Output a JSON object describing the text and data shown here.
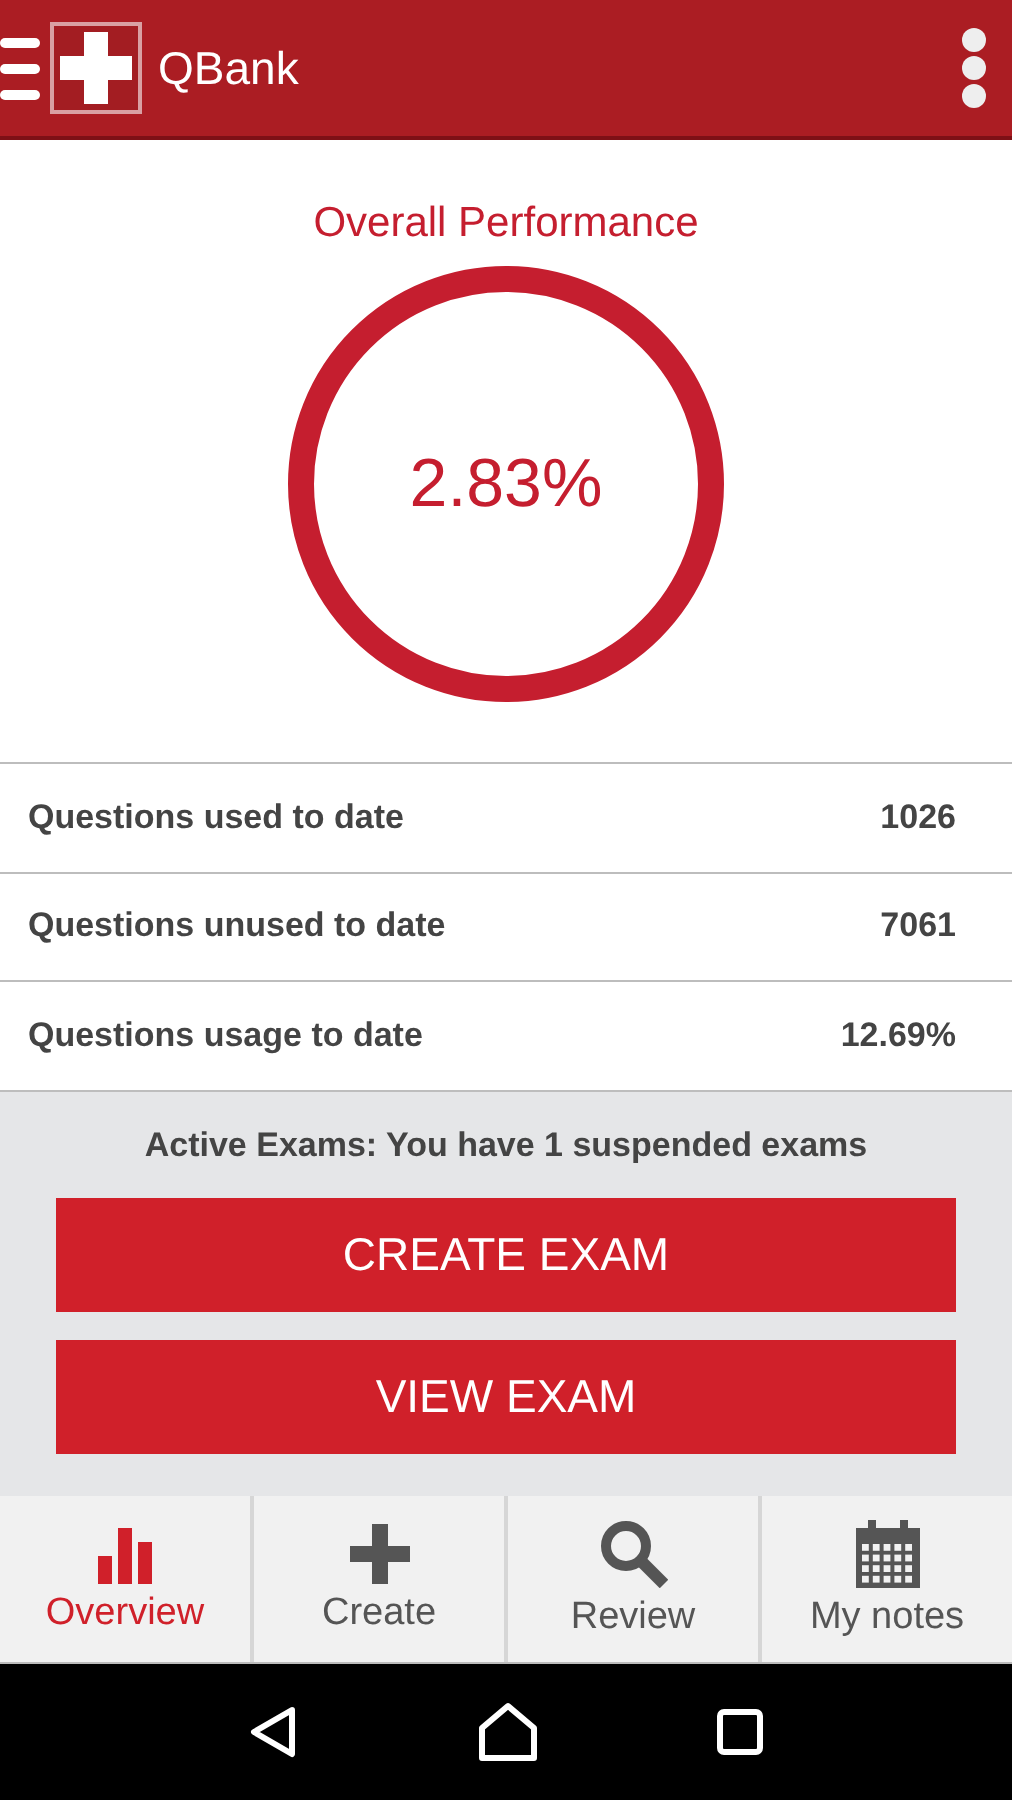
{
  "app_bar": {
    "title": "QBank"
  },
  "performance": {
    "title": "Overall Performance",
    "value": "2.83%"
  },
  "stats": [
    {
      "label": "Questions used to date",
      "value": "1026"
    },
    {
      "label": "Questions unused to date",
      "value": "7061"
    },
    {
      "label": "Questions usage to date",
      "value": "12.69%"
    }
  ],
  "exams": {
    "status": "Active Exams: You have 1 suspended exams",
    "buttons": [
      "CREATE EXAM",
      "VIEW EXAM"
    ]
  },
  "bottom_nav": [
    {
      "label": "Overview",
      "selected": true
    },
    {
      "label": "Create",
      "selected": false
    },
    {
      "label": "Review",
      "selected": false
    },
    {
      "label": "My notes",
      "selected": false
    }
  ]
}
